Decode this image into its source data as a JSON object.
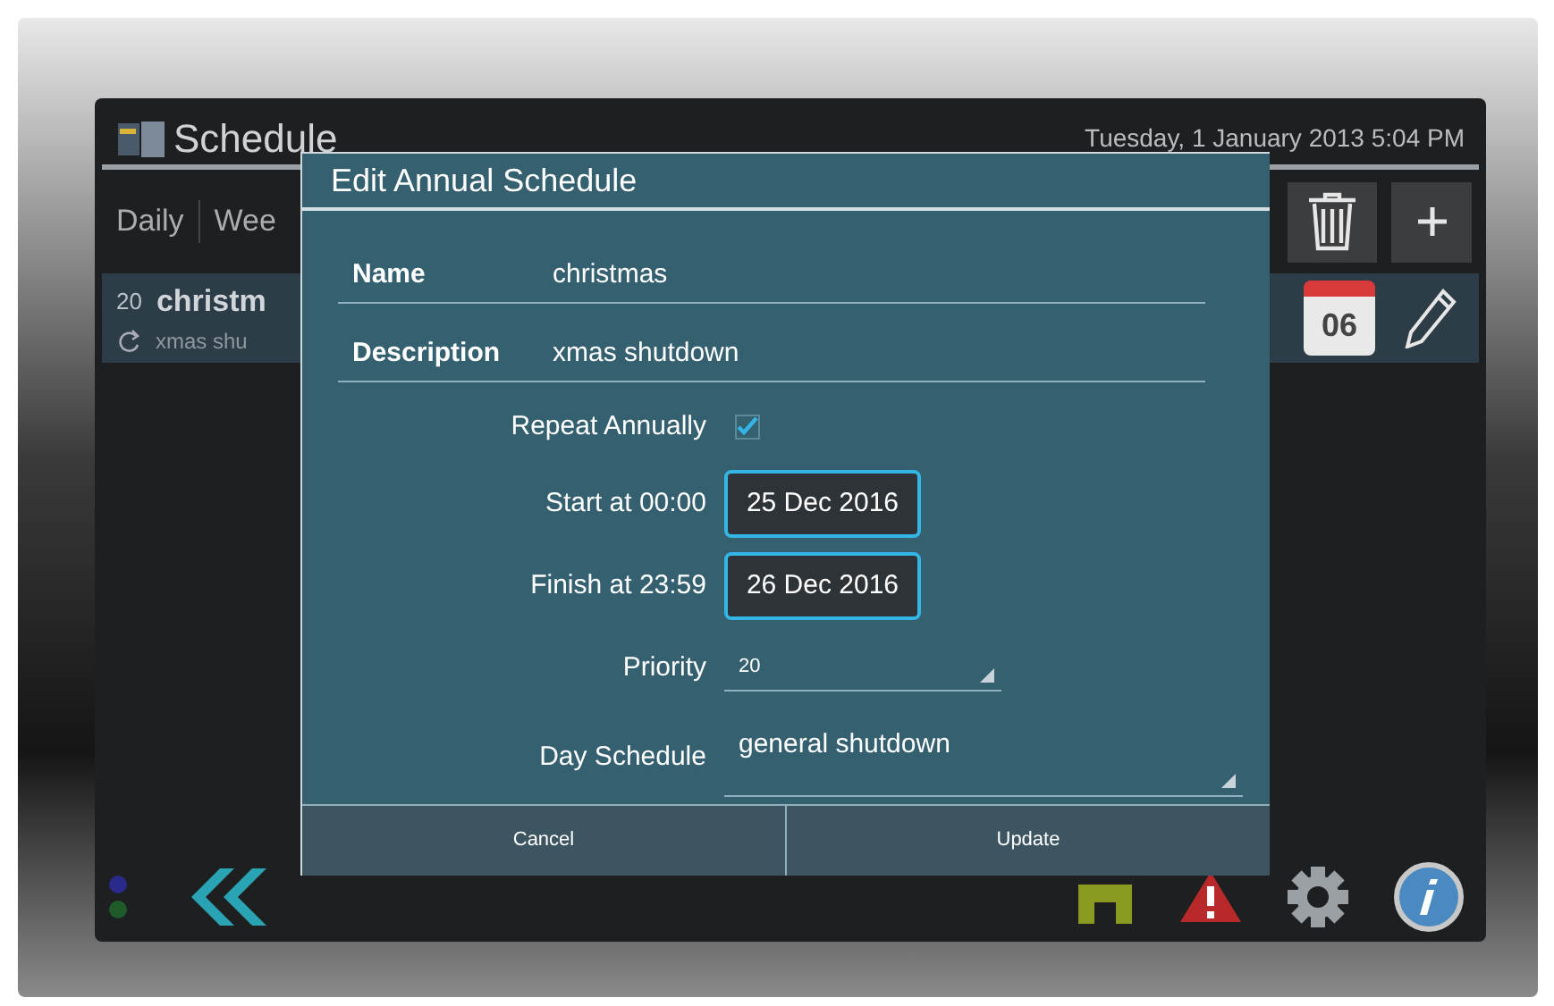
{
  "header": {
    "title": "Schedule",
    "datetime": "Tuesday, 1 January 2013 5:04 PM"
  },
  "tabs": [
    {
      "label": "Daily",
      "selected": false
    },
    {
      "label": "Wee",
      "selected": false
    }
  ],
  "list_item": {
    "priority": "20",
    "name": "christm",
    "description": "xmas shu",
    "calendar_day": "06"
  },
  "dialog": {
    "title": "Edit Annual Schedule",
    "name": {
      "label": "Name",
      "value": "christmas"
    },
    "description": {
      "label": "Description",
      "value": "xmas shutdown"
    },
    "repeat": {
      "label": "Repeat Annually",
      "checked": true
    },
    "start": {
      "label": "Start at 00:00",
      "value": "25 Dec 2016"
    },
    "finish": {
      "label": "Finish at 23:59",
      "value": "26 Dec 2016"
    },
    "priority": {
      "label": "Priority",
      "value": "20"
    },
    "day_schedule": {
      "label": "Day Schedule",
      "value": "general shutdown"
    },
    "buttons": [
      "Cancel",
      "Update"
    ]
  }
}
